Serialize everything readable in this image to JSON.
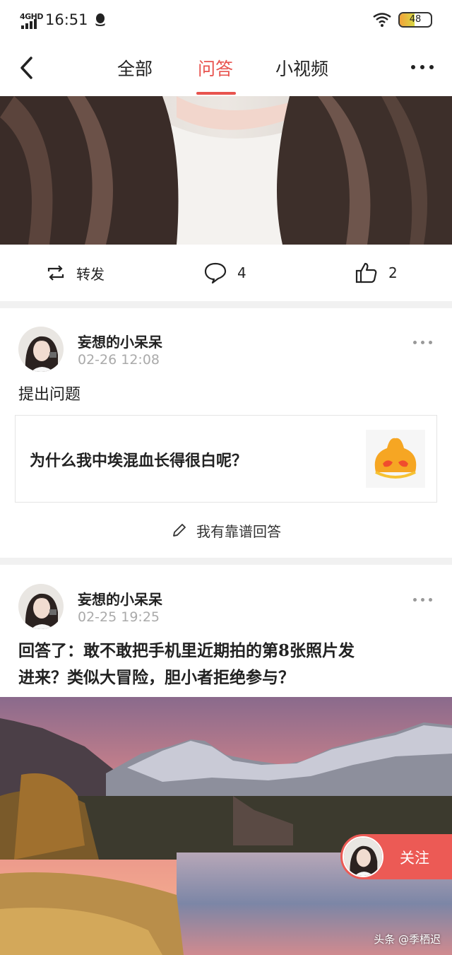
{
  "status_bar": {
    "network": "4GHD",
    "time": "16:51",
    "battery": "48",
    "battery_level": 0.48
  },
  "nav": {
    "tabs": [
      {
        "label": "全部",
        "active": false
      },
      {
        "label": "问答",
        "active": true
      },
      {
        "label": "小视频",
        "active": false
      }
    ]
  },
  "post1": {
    "repost_label": "转发",
    "comment_count": "4",
    "like_count": "2"
  },
  "question_card": {
    "username": "妄想的小呆呆",
    "time": "02-26 12:08",
    "action_label": "提出问题",
    "question": "为什么我中埃混血长得很白呢？",
    "answer_button": "我有靠谱回答"
  },
  "answer_card": {
    "username": "妄想的小呆呆",
    "time": "02-25 19:25",
    "title_line1": "回答了：敢不敢把手机里近期拍的第8张照片发",
    "title_line2": "进来？类似大冒险，胆小者拒绝参与？",
    "follow_label": "关注",
    "watermark": "头条 @季栖迟"
  },
  "colors": {
    "accent": "#e8544f",
    "follow_bg": "#ec5a55",
    "divider": "#f1f1f1"
  },
  "icons": [
    "back-icon",
    "more-icon",
    "repost-icon",
    "comment-icon",
    "like-icon",
    "pencil-icon",
    "qq-icon",
    "wifi-icon"
  ]
}
